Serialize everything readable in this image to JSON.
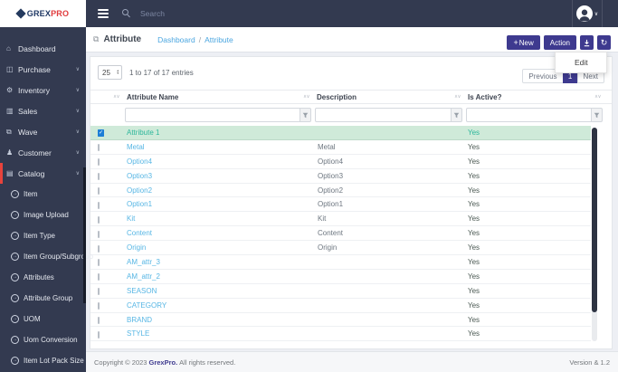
{
  "brand": {
    "name_primary": "GREX",
    "name_secondary": "PRO",
    "logo_icon": "diamond-logo-icon"
  },
  "colors": {
    "accent_purple": "#3e3a8f",
    "link_blue": "#57b6e4",
    "selected_row_bg": "#cfead9",
    "selected_row_text": "#2db79b",
    "sidebar_dark": "#333a50",
    "active_item_red": "#e8433c"
  },
  "navbar": {
    "search_placeholder": "Search",
    "hamburger_icon": "hamburger-icon",
    "search_icon": "search-icon",
    "user_icon": "user-avatar-icon"
  },
  "breadcrumb": {
    "section_icon": "book-icon",
    "title": "Attribute",
    "separator": "/",
    "links": [
      "Dashboard",
      "Attribute"
    ]
  },
  "sidebar": {
    "items": [
      {
        "label": "Dashboard",
        "icon": "home-icon",
        "chevron": false,
        "active": false
      },
      {
        "label": "Purchase",
        "icon": "purchase-icon",
        "chevron": true,
        "active": false
      },
      {
        "label": "Inventory",
        "icon": "inventory-icon",
        "chevron": true,
        "active": false
      },
      {
        "label": "Sales",
        "icon": "sales-icon",
        "chevron": true,
        "active": false
      },
      {
        "label": "Wave",
        "icon": "wave-icon",
        "chevron": true,
        "active": false
      },
      {
        "label": "Customer",
        "icon": "customer-icon",
        "chevron": true,
        "active": false
      },
      {
        "label": "Catalog",
        "icon": "catalog-icon",
        "chevron": true,
        "active": true
      }
    ],
    "submenu": [
      {
        "label": "Item"
      },
      {
        "label": "Image Upload"
      },
      {
        "label": "Item Type"
      },
      {
        "label": "Item Group/Subgroup"
      },
      {
        "label": "Attributes"
      },
      {
        "label": "Attribute Group"
      },
      {
        "label": "UOM"
      },
      {
        "label": "Uom Conversion"
      },
      {
        "label": "Item Lot Pack Size"
      }
    ]
  },
  "toolbar": {
    "plus": "+",
    "new_label": "New",
    "action_label": "Action",
    "download_icon": "download-icon",
    "refresh_icon": "refresh-icon",
    "action_menu": {
      "edit_label": "Edit"
    }
  },
  "pagination": {
    "previous": "Previous",
    "page": "1",
    "next": "Next"
  },
  "table": {
    "page_size": "25",
    "entries_info": "1 to 17 of 17 entries",
    "columns": {
      "name": "Attribute Name",
      "description": "Description",
      "active": "Is Active?"
    },
    "rows": [
      {
        "name": "Attribute 1",
        "description": "",
        "active": "Yes",
        "selected": true
      },
      {
        "name": "Metal",
        "description": "Metal",
        "active": "Yes",
        "selected": false
      },
      {
        "name": "Option4",
        "description": "Option4",
        "active": "Yes",
        "selected": false
      },
      {
        "name": "Option3",
        "description": "Option3",
        "active": "Yes",
        "selected": false
      },
      {
        "name": "Option2",
        "description": "Option2",
        "active": "Yes",
        "selected": false
      },
      {
        "name": "Option1",
        "description": "Option1",
        "active": "Yes",
        "selected": false
      },
      {
        "name": "Kit",
        "description": "Kit",
        "active": "Yes",
        "selected": false
      },
      {
        "name": "Content",
        "description": "Content",
        "active": "Yes",
        "selected": false
      },
      {
        "name": "Origin",
        "description": "Origin",
        "active": "Yes",
        "selected": false
      },
      {
        "name": "AM_attr_3",
        "description": "",
        "active": "Yes",
        "selected": false
      },
      {
        "name": "AM_attr_2",
        "description": "",
        "active": "Yes",
        "selected": false
      },
      {
        "name": "SEASON",
        "description": "",
        "active": "Yes",
        "selected": false
      },
      {
        "name": "CATEGORY",
        "description": "",
        "active": "Yes",
        "selected": false
      },
      {
        "name": "BRAND",
        "description": "",
        "active": "Yes",
        "selected": false
      },
      {
        "name": "STYLE",
        "description": "",
        "active": "Yes",
        "selected": false
      }
    ]
  },
  "footer": {
    "copyright_prefix": "Copyright © 2023",
    "brand": "GrexPro.",
    "copyright_suffix": "All rights reserved.",
    "version": "Version & 1.2"
  }
}
